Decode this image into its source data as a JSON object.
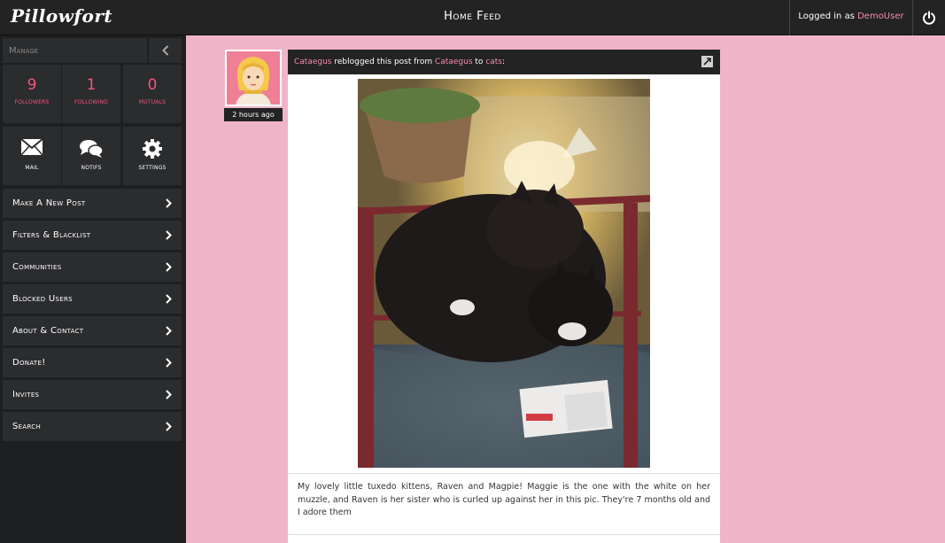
{
  "app": {
    "logo": "Pillowfort",
    "page_title": "Home Feed"
  },
  "session": {
    "logged_in_prefix": "Logged in as ",
    "username": "DemoUser"
  },
  "sidebar": {
    "manage_placeholder": "Manage",
    "stats": [
      {
        "value": "9",
        "label": "followers"
      },
      {
        "value": "1",
        "label": "following"
      },
      {
        "value": "0",
        "label": "mutuals"
      }
    ],
    "tiles": [
      {
        "label": "mail",
        "icon": "envelope-icon"
      },
      {
        "label": "notifs",
        "icon": "chat-bubbles-icon"
      },
      {
        "label": "settings",
        "icon": "gear-icon"
      }
    ],
    "menu": [
      "Make A New Post",
      "Filters & Blacklist",
      "Communities",
      "Blocked Users",
      "About & Contact",
      "Donate!",
      "Invites",
      "Search"
    ]
  },
  "post": {
    "timestamp": "2 hours ago",
    "author": "Cataegus",
    "reblog_text": " reblogged this post from ",
    "source_author": "Cataegus",
    "to_text": " to ",
    "community": "cats",
    "colon": ":",
    "body": "My lovely little tuxedo kittens, Raven and Magpie! Maggie is the one with the white on her muzzle, and Raven is her sister who is curled up against her in this pic. They're 7 months old and I adore them"
  },
  "colors": {
    "accent": "#f2557e",
    "link": "#f58ca8",
    "background": "#f0b4c8",
    "bar": "#232323"
  }
}
